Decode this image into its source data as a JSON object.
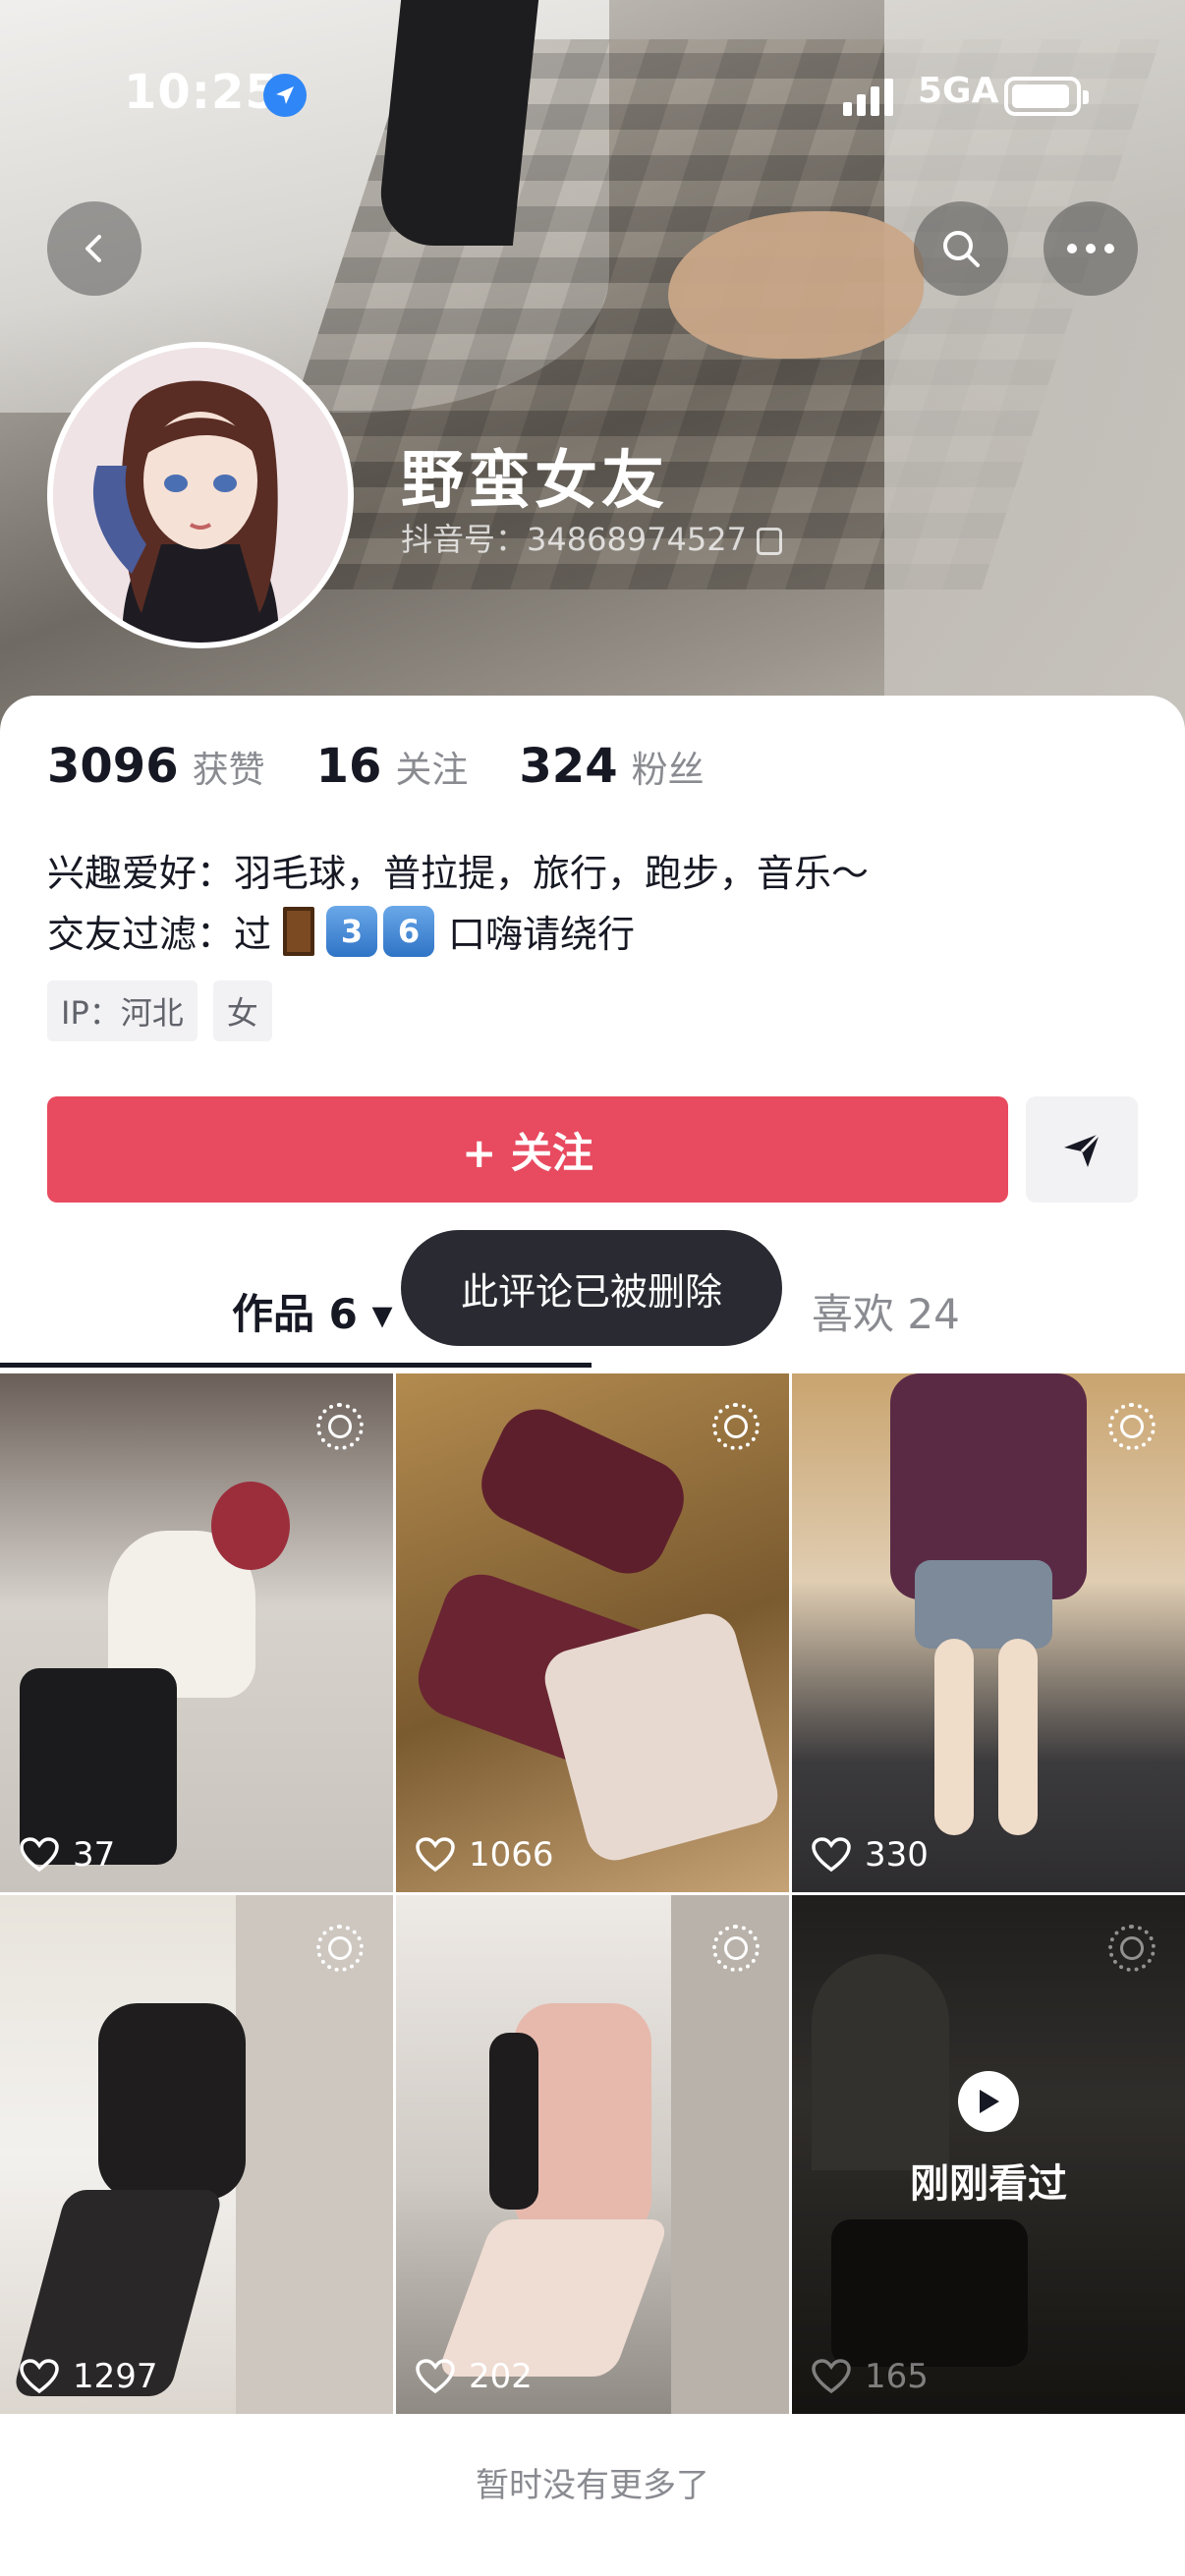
{
  "status_bar": {
    "time": "10:25",
    "network": "5GA"
  },
  "profile": {
    "nickname": "野蛮女友",
    "douyin_id": "抖音号：34868974527"
  },
  "stats": [
    {
      "value": "3096",
      "label": "获赞"
    },
    {
      "value": "16",
      "label": "关注"
    },
    {
      "value": "324",
      "label": "粉丝"
    }
  ],
  "bio": {
    "line1": "兴趣爱好：羽毛球，普拉提，旅行，跑步，音乐～",
    "line2_prefix": "交友过滤：过",
    "line2_key1": "3",
    "line2_key2": "6",
    "line2_suffix": "口嗨请绕行"
  },
  "tags": [
    "IP：河北",
    "女"
  ],
  "actions": {
    "follow_label": "+ 关注"
  },
  "tabs": {
    "works": "作品 6 ▾",
    "likes": "喜欢 24"
  },
  "toast": "此评论已被删除",
  "videos": [
    {
      "likes": "37"
    },
    {
      "likes": "1066"
    },
    {
      "likes": "330"
    },
    {
      "likes": "1297"
    },
    {
      "likes": "202"
    },
    {
      "likes": "165",
      "overlay": "刚刚看过"
    }
  ],
  "footer": "暂时没有更多了",
  "colors": {
    "accent": "#e84a5f",
    "location": "#2f86f6"
  },
  "icons": [
    "back-icon",
    "search-icon",
    "more-icon",
    "location-arrow-icon",
    "copy-icon",
    "send-icon",
    "live-icon",
    "heart-icon",
    "play-icon"
  ]
}
